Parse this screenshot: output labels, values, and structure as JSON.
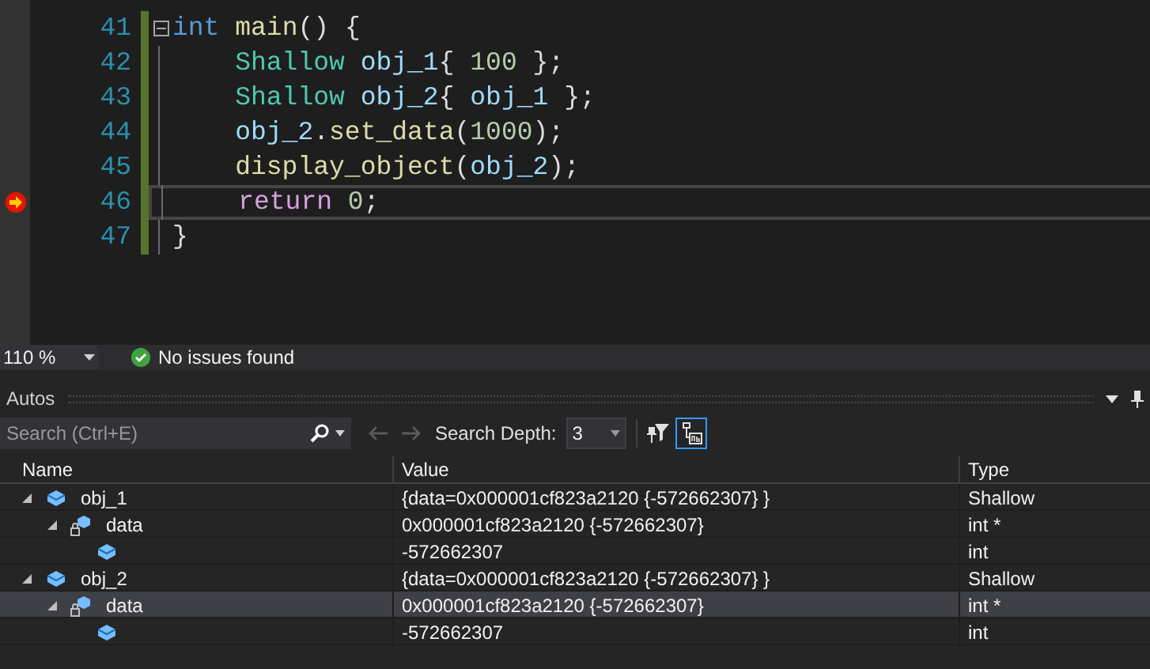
{
  "editor": {
    "lines": [
      {
        "number": "41",
        "current": false,
        "fold": true,
        "tokens": [
          {
            "kind": "keyword",
            "text": "int"
          },
          {
            "kind": "func",
            "text": " main"
          },
          {
            "kind": "plain",
            "text": "() {"
          }
        ]
      },
      {
        "number": "42",
        "current": false,
        "fold": false,
        "tokens": [
          {
            "kind": "type",
            "text": "    Shallow"
          },
          {
            "kind": "var",
            "text": " obj_1"
          },
          {
            "kind": "plain",
            "text": "{ "
          },
          {
            "kind": "number",
            "text": "100"
          },
          {
            "kind": "plain",
            "text": " };"
          }
        ]
      },
      {
        "number": "43",
        "current": false,
        "fold": false,
        "tokens": [
          {
            "kind": "type",
            "text": "    Shallow"
          },
          {
            "kind": "var",
            "text": " obj_2"
          },
          {
            "kind": "plain",
            "text": "{ "
          },
          {
            "kind": "var",
            "text": "obj_1"
          },
          {
            "kind": "plain",
            "text": " };"
          }
        ]
      },
      {
        "number": "44",
        "current": false,
        "fold": false,
        "tokens": [
          {
            "kind": "var",
            "text": "    obj_2"
          },
          {
            "kind": "plain",
            "text": "."
          },
          {
            "kind": "func",
            "text": "set_data"
          },
          {
            "kind": "plain",
            "text": "("
          },
          {
            "kind": "number",
            "text": "1000"
          },
          {
            "kind": "plain",
            "text": ");"
          }
        ]
      },
      {
        "number": "45",
        "current": false,
        "fold": false,
        "tokens": [
          {
            "kind": "func",
            "text": "    display_object"
          },
          {
            "kind": "plain",
            "text": "("
          },
          {
            "kind": "var",
            "text": "obj_2"
          },
          {
            "kind": "plain",
            "text": ");"
          }
        ]
      },
      {
        "number": "46",
        "current": true,
        "fold": false,
        "tokens": [
          {
            "kind": "control",
            "text": "    return"
          },
          {
            "kind": "number",
            "text": " 0"
          },
          {
            "kind": "plain",
            "text": ";"
          }
        ]
      },
      {
        "number": "47",
        "current": false,
        "fold": false,
        "tokens": [
          {
            "kind": "plain",
            "text": "}"
          }
        ]
      }
    ]
  },
  "status_bar": {
    "zoom": "110 %",
    "issues": "No issues found"
  },
  "autos": {
    "title": "Autos",
    "search": {
      "placeholder": "Search (Ctrl+E)"
    },
    "search_depth_label": "Search Depth:",
    "search_depth": "3",
    "columns": [
      "Name",
      "Value",
      "Type"
    ],
    "rows": [
      {
        "name": "obj_1",
        "value": "{data=0x000001cf823a2120 {-572662307} }",
        "type": "Shallow",
        "kind": "object",
        "expanded": true,
        "selected": false,
        "children": [
          {
            "name": "data",
            "value": "0x000001cf823a2120 {-572662307}",
            "type": "int *",
            "kind": "private",
            "expanded": true,
            "selected": false,
            "children": [
              {
                "value": "-572662307",
                "type": "int",
                "kind": "object",
                "selected": false
              }
            ]
          }
        ]
      },
      {
        "name": "obj_2",
        "value": "{data=0x000001cf823a2120 {-572662307} }",
        "type": "Shallow",
        "kind": "object",
        "expanded": true,
        "selected": false,
        "children": [
          {
            "name": "data",
            "value": "0x000001cf823a2120 {-572662307}",
            "type": "int *",
            "kind": "private",
            "expanded": true,
            "selected": true,
            "children": [
              {
                "value": "-572662307",
                "type": "int",
                "kind": "object",
                "selected": false
              }
            ]
          }
        ]
      }
    ]
  }
}
